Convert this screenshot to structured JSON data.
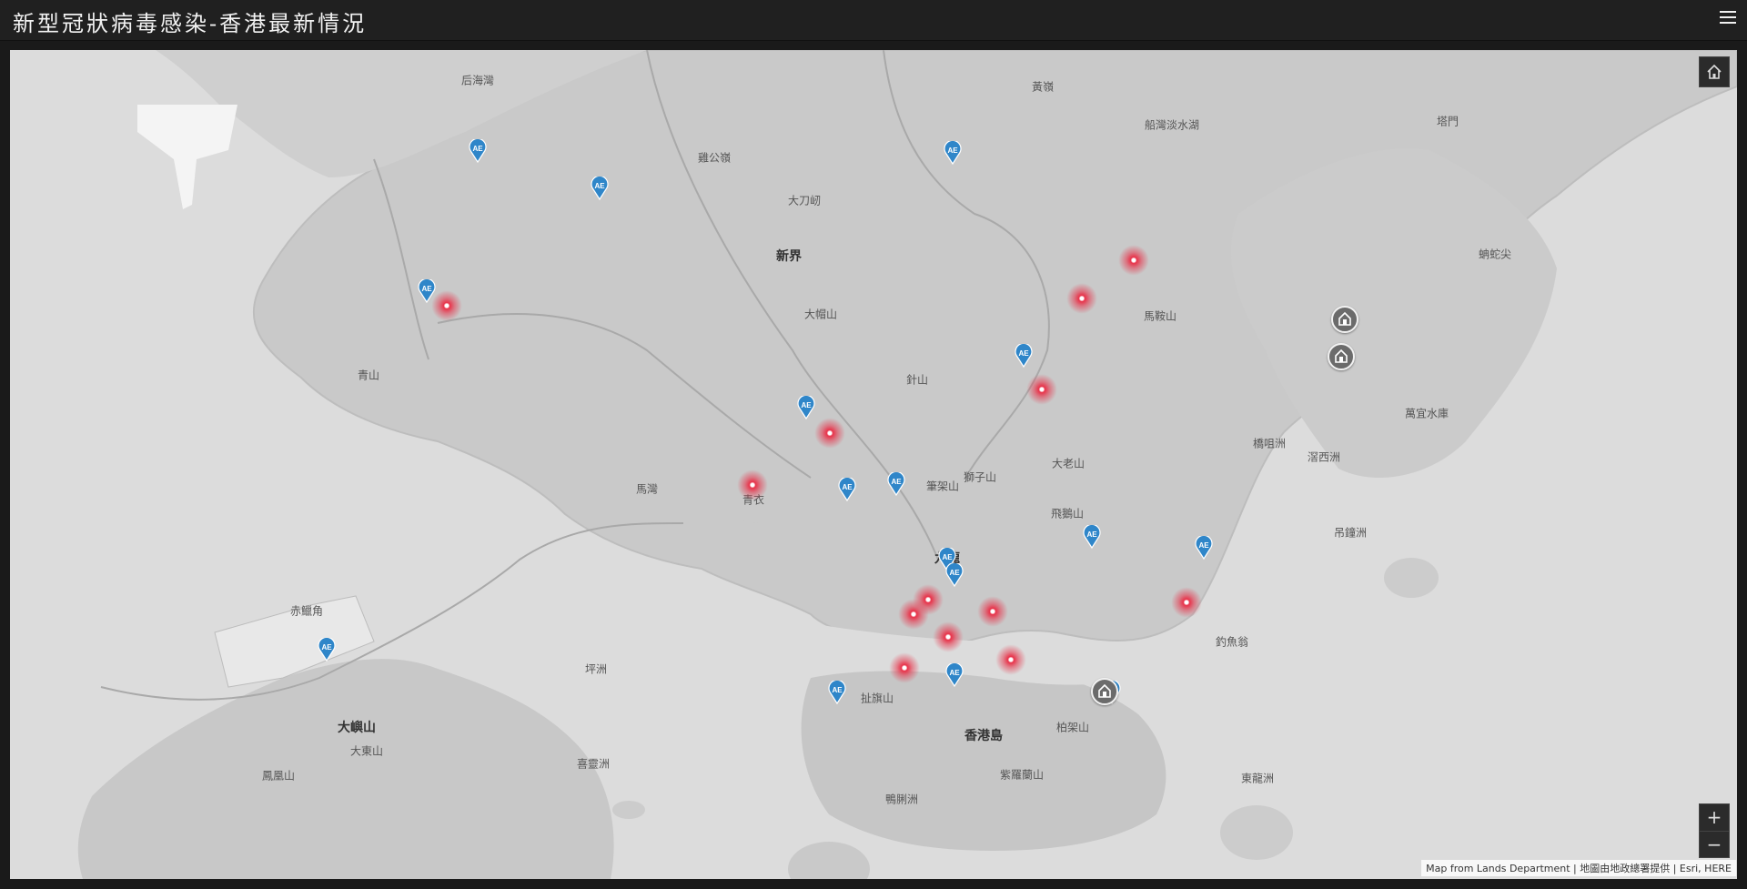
{
  "header": {
    "title": "新型冠狀病毒感染-香港最新情況"
  },
  "icons": {
    "menu": "hamburger-menu-icon",
    "home": "home-icon",
    "zoom_in": "plus-icon",
    "zoom_out": "minus-icon"
  },
  "colors": {
    "header_bg": "#202020",
    "hotspot": "#e8334a",
    "ae_pin": "#2f86c9",
    "shelter": "#6b6b6b"
  },
  "map": {
    "labels": [
      "后海灣",
      "黃嶺",
      "船灣淡水湖",
      "塔門",
      "雞公嶺",
      "大刀屻",
      "新界",
      "蚺蛇尖",
      "大帽山",
      "馬鞍山",
      "青山",
      "針山",
      "萬宜水庫",
      "橋咀洲",
      "滘西洲",
      "大老山",
      "筆架山",
      "獅子山",
      "馬灣",
      "青衣",
      "飛鵝山",
      "吊鐘洲",
      "九龍",
      "赤鱲角",
      "坪洲",
      "扯旗山",
      "釣魚翁",
      "大嶼山",
      "香港島",
      "柏架山",
      "大東山",
      "喜靈洲",
      "鳳凰山",
      "紫羅蘭山",
      "東龍洲",
      "鴨脷洲"
    ],
    "ae_label": "AE",
    "zoom": {
      "in": "+",
      "out": "−"
    }
  },
  "attribution": "Map from Lands Department | 地圖由地政總署提供 | Esri, HERE"
}
